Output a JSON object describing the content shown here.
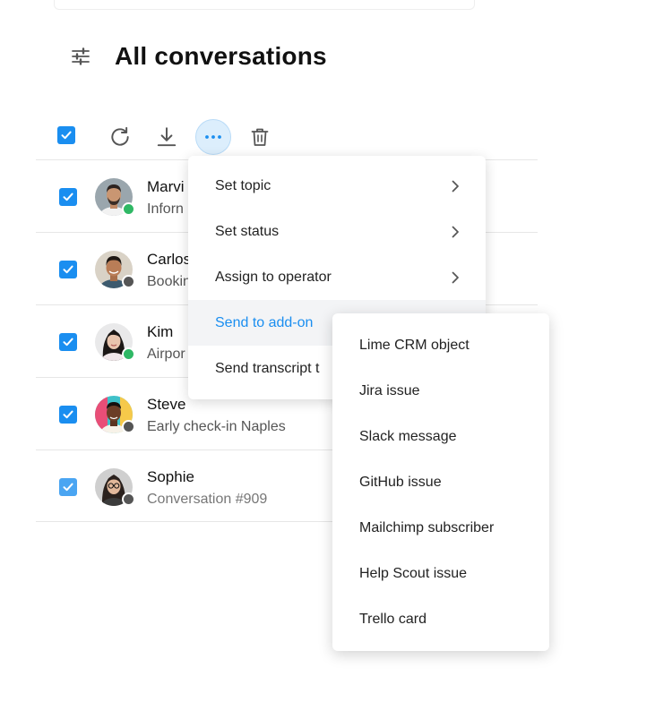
{
  "header": {
    "title": "All conversations",
    "filter_icon": "sliders-icon"
  },
  "toolbar": {
    "icons": [
      "checkbox-icon",
      "refresh-icon",
      "download-icon",
      "more-icon",
      "trash-icon"
    ]
  },
  "colors": {
    "accent": "#1a8ef0",
    "online": "#2fb865",
    "offline": "#555555"
  },
  "conversations": [
    {
      "name": "Marvi",
      "subject": "Inforn",
      "status": "online"
    },
    {
      "name": "Carlos",
      "subject": "Bookin",
      "status": "offline"
    },
    {
      "name": "Kim",
      "subject": "Airpor",
      "status": "online"
    },
    {
      "name": "Steve",
      "subject": "Early check-in Naples",
      "status": "offline"
    },
    {
      "name": "Sophie",
      "subject": "Conversation #909",
      "status": "offline"
    }
  ],
  "menu": {
    "items": [
      {
        "label": "Set topic",
        "has_submenu": true
      },
      {
        "label": "Set status",
        "has_submenu": true
      },
      {
        "label": "Assign to operator",
        "has_submenu": true
      },
      {
        "label": "Send to add-on",
        "active": true
      },
      {
        "label": "Send transcript t"
      }
    ]
  },
  "submenu": {
    "items": [
      {
        "label": "Lime CRM object"
      },
      {
        "label": "Jira issue"
      },
      {
        "label": "Slack message"
      },
      {
        "label": "GitHub issue"
      },
      {
        "label": "Mailchimp subscriber"
      },
      {
        "label": "Help Scout issue"
      },
      {
        "label": "Trello card"
      }
    ]
  }
}
